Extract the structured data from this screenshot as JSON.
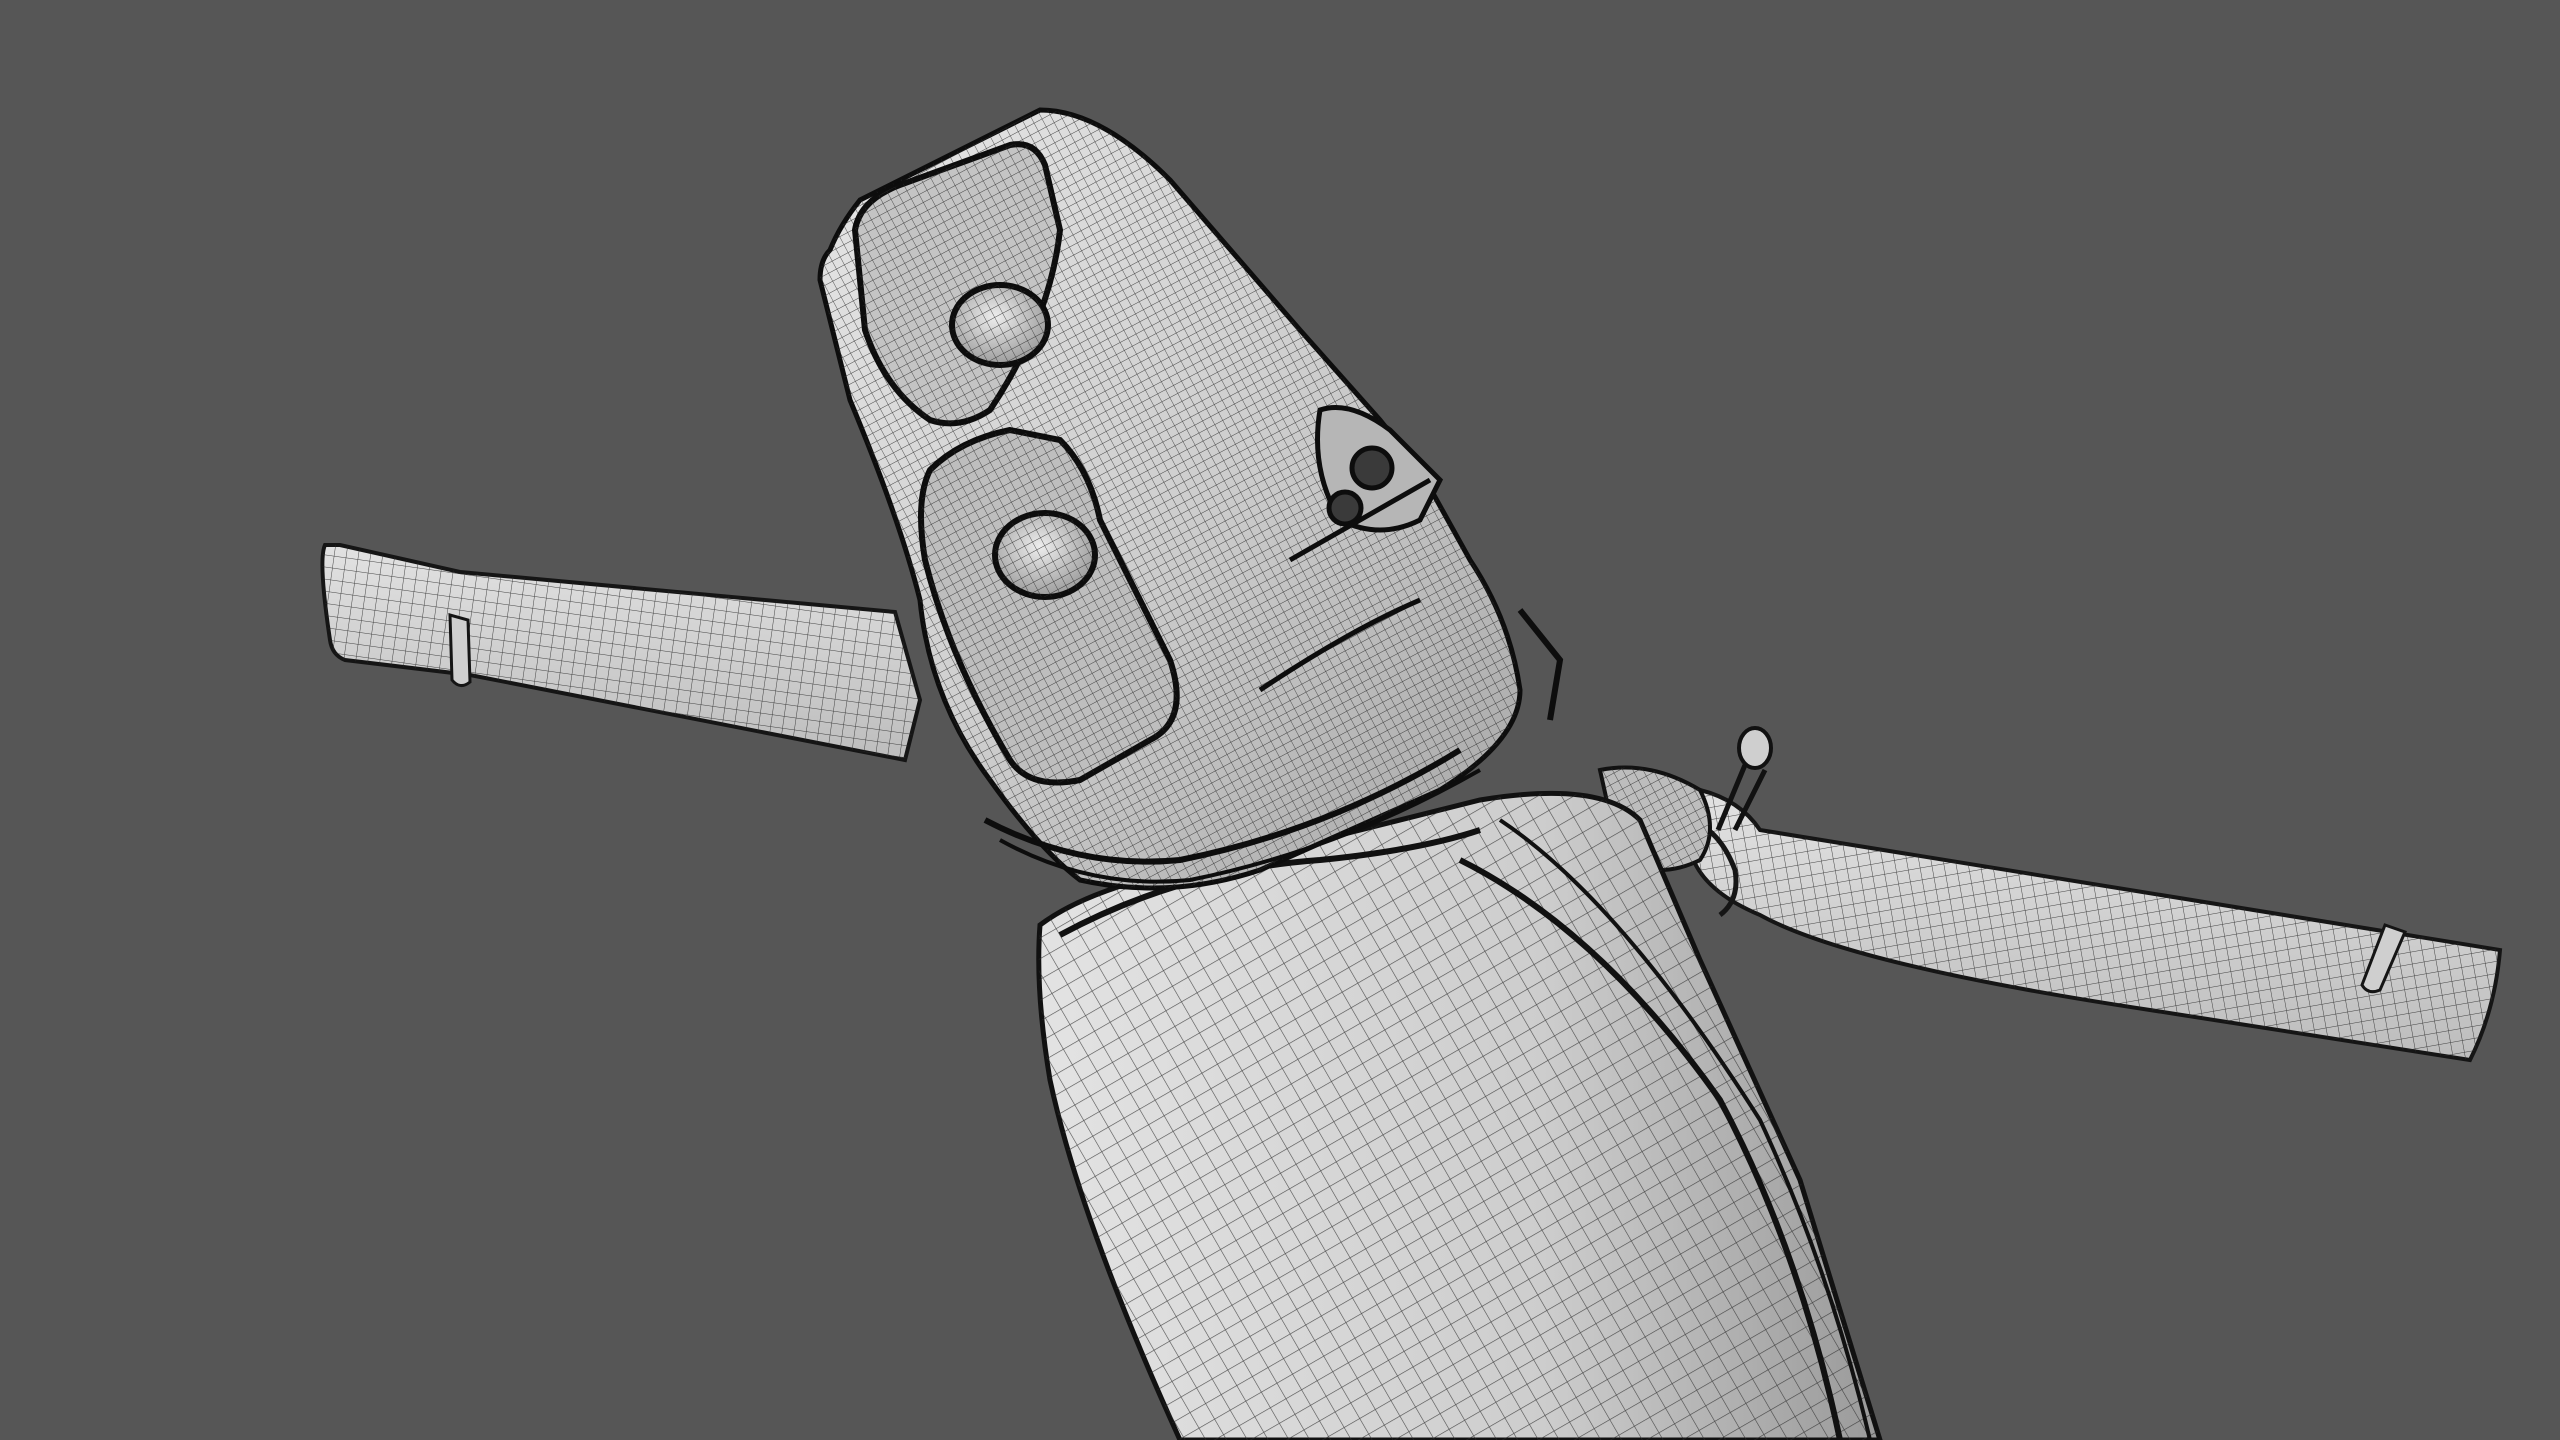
{
  "viewport": {
    "background_color": "#565656",
    "render_style": "wireframe-on-shaded",
    "subject": "drone"
  },
  "model": {
    "surface_light": "#d9d9d9",
    "surface_mid": "#b8b8b8",
    "surface_dark": "#8c8c8c",
    "wire_color": "#2a2a2a",
    "edge_color": "#111111",
    "parts": [
      "fuselage-nose",
      "camera-sensor-upper",
      "camera-sensor-lower",
      "side-sensor-pair",
      "left-arm",
      "right-arm",
      "lower-body",
      "gimbal-joint"
    ]
  }
}
